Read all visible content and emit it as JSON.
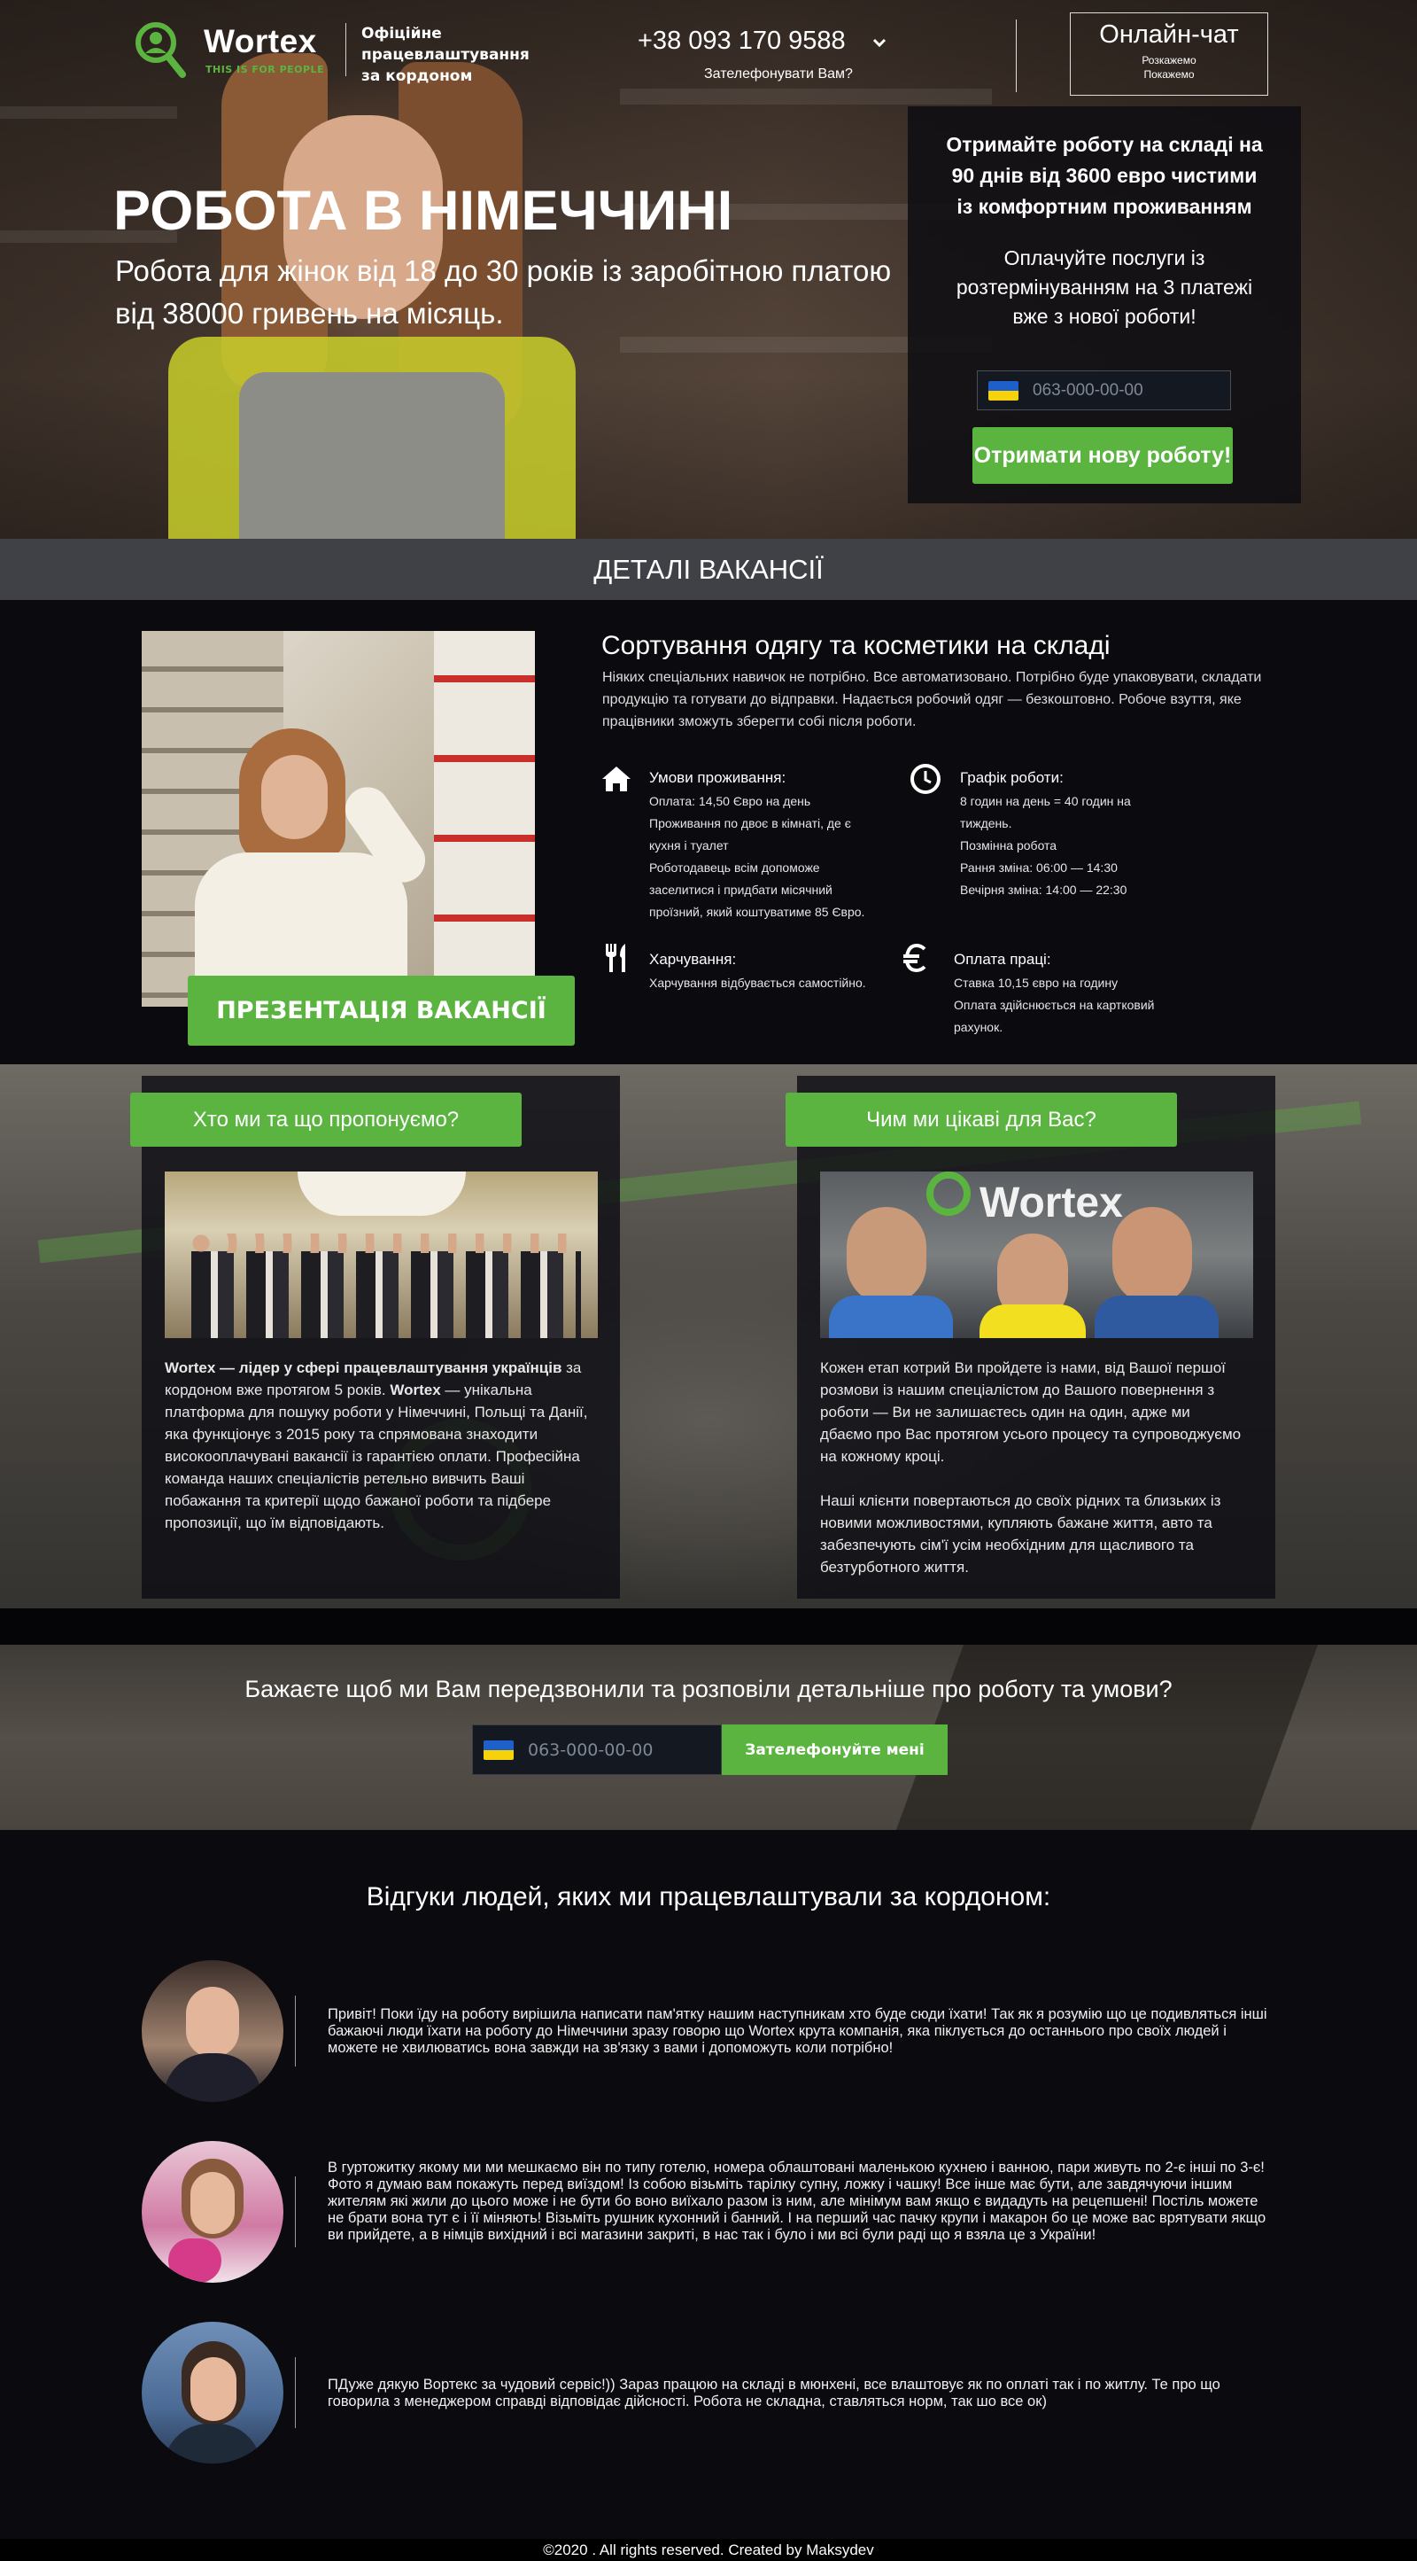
{
  "header": {
    "brand": "Wortex",
    "tagline": "THIS IS FOR PEOPLE",
    "subtitle": "Офіційне працевлаштування за кордоном",
    "phone": "+38 093 170 9588",
    "callback_link": "Зателефонувати Вам?",
    "chat_label": "Онлайн-чат",
    "chat_sub1": "Розкажемо",
    "chat_sub2": "Покажемо"
  },
  "hero": {
    "title": "РОБОТА В НІМЕЧЧИНІ",
    "subtitle": "Робота для жінок від 18 до 30 років із заробітною платою від 38000 гривень на місяць."
  },
  "offer": {
    "heading": "Отримайте роботу на складі на 90 днів від 3600 евро чистими із комфортним проживанням",
    "text": "Оплачуйте послуги із розтермінуванням на 3 платежі вже з нової роботи!",
    "phone_placeholder": "063-000-00-00",
    "button": "Отримати нову роботу!"
  },
  "details_bar": "ДЕТАЛІ ВАКАНСІЇ",
  "vacancy": {
    "title": "Сортування одягу та косметики на складі",
    "description": "Ніяких спеціальних навичок не потрібно. Все автоматизовано. Потрібно буде упаковувати, складати продукцію та готувати до відправки. Надається робочий одяг — безкоштовно. Робоче взуття, яке працівники зможуть зберегти собі після роботи.",
    "presentation_button": "ПРЕЗЕНТАЦІЯ ВАКАНСІЇ",
    "features": [
      {
        "icon": "home-icon",
        "title": "Умови проживання:",
        "lines": [
          "Оплата: 14,50 Євро на день",
          "Проживання по двоє в кімнаті, де є",
          "кухня і туалет",
          "Роботодавець всім допоможе",
          "заселитися і придбати місячний",
          "проїзний, який коштуватиме 85 Євро."
        ]
      },
      {
        "icon": "clock-icon",
        "title": "Графік роботи:",
        "lines": [
          "8 годин на день = 40 годин на",
          "тиждень.",
          "Позмінна робота",
          "Рання зміна: 06:00 — 14:30",
          "Вечірня зміна: 14:00 — 22:30"
        ]
      },
      {
        "icon": "fork-knife-icon",
        "title": "Харчування:",
        "lines": [
          "Харчування відбувається самостійно."
        ]
      },
      {
        "icon": "euro-icon",
        "title": "Оплата праці:",
        "lines": [
          "Ставка 10,15 євро на годину",
          "Оплата здійснюється на картковий",
          "рахунок."
        ]
      }
    ]
  },
  "about": {
    "left_title": "Хто ми та що пропонуємо?",
    "left_bold1": "Wortex — лідер у сфері працевлаштування українців",
    "left_text1": " за кордоном вже протягом 5 років. ",
    "left_bold2": "Wortex",
    "left_text2": " — унікальна платформа для пошуку роботи у Німеччині, Польщі та Данії, яка функціонує з 2015 року та спрямована знаходити високооплачувані вакансії із гарантією оплати. Професійна команда наших спеціалістів ретельно вивчить Ваші побажання та критерії щодо бажаної роботи та підбере пропозиції, що їм відповідають.",
    "right_title": "Чим ми цікаві для Вас?",
    "right_p1": "Кожен етап котрий Ви пройдете із нами, від Вашої першої розмови із нашим спеціалістом до Вашого повернення з роботи — Ви не залишаєтесь один на один, адже ми дбаємо про Вас протягом усього процесу та супроводжуємо на кожному кроці.",
    "right_p2": "Наші клієнти повертаються до своїх рідних та близьких із новими можливостями, купляють бажане життя, авто та забезпечують сім'ї усім необхідним для щасливого та безтурботного життя.",
    "photo_sign": "Wortex"
  },
  "callback": {
    "title": "Бажаєте щоб ми Вам передзвонили та розповіли детальніше про роботу та умови?",
    "phone_placeholder": "063-000-00-00",
    "button": "Зателефонуйте мені"
  },
  "reviews": {
    "title": "Відгуки людей, яких ми працевлаштували за кордоном:",
    "items": [
      {
        "text": "Привіт! Поки їду на роботу вирішила написати пам'ятку нашим наступникам хто буде сюди їхати! Так як я розумію що це подивляться інші бажаючі люди їхати на роботу до Німеччини зразу говорю що Wortex крута компанія, яка піклується до останнього про своїх людей і можете не хвилюватись вона завжди на зв'язку з вами і допоможуть коли потрібно!"
      },
      {
        "text": "В гуртожитку якому ми ми мешкаємо він по типу готелю, номера облаштовані маленькою кухнею і ванною, пари живуть по 2-є інші по 3-є! Фото я думаю вам покажуть перед виїздом! Із собою візьміть тарілку супну, ложку і чашку! Все інше має бути, але завдячуючи іншим жителям які жили до цього може і не бути бо воно виїхало разом із ним, але мінімум вам якщо є видадуть на рецепшені! Постіль можете не брати вона тут є і її міняють! Візьміть рушник кухонний і банний. І на перший час пачку крупи і макарон бо це може вас врятувати якщо ви прийдете, а в німців вихідний і всі магазини закриті, в нас так і було і ми всі були раді що я взяла це з України!"
      },
      {
        "text": "ПДуже дякую Вортекс за чудовий сервіс!)) Зараз працюю на складі в мюнхені, все влаштовує як по оплаті так і по житлу. Те про що говорила з менеджером справді відповідає дійсності. Робота не складна, ставляться норм, так шо все ок)"
      }
    ]
  },
  "footer": "©2020  . All rights reserved. Created by   Maksydev",
  "colors": {
    "accent": "#5bb440",
    "dark": "#0a0a0f"
  }
}
